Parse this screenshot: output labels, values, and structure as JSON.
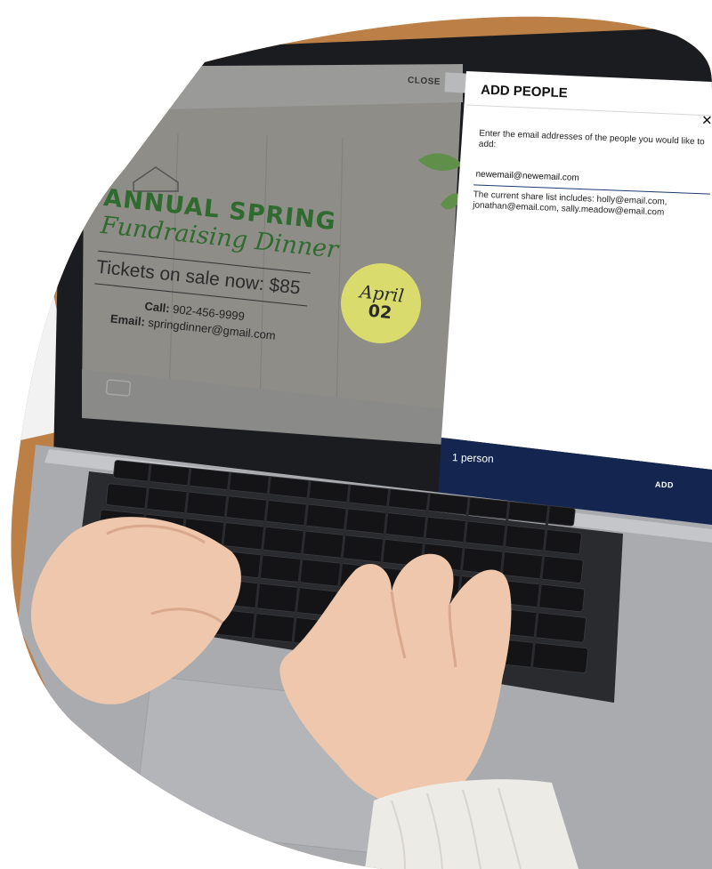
{
  "screen": {
    "close_label": "CLOSE"
  },
  "flyer": {
    "title_line1": "ANNUAL SPRING",
    "title_line2": "Fundraising Dinner",
    "tickets": "Tickets on sale now: $85",
    "call_label": "Call:",
    "call_value": "902-456-9999",
    "email_label": "Email:",
    "email_value": "springdinner@gmail.com",
    "date_month": "April",
    "date_day": "02"
  },
  "dialog": {
    "title": "ADD PEOPLE",
    "close_glyph": "✕",
    "prompt": "Enter the email addresses of the people you would like to add:",
    "input_value": "newemail@newemail.com",
    "share_list": "The current share list includes:  holly@email.com, jonathan@email.com, sally.meadow@email.com",
    "count": "1 person",
    "add_label": "ADD"
  },
  "colors": {
    "dialog_footer": "#14254f",
    "input_underline": "#1b3a73",
    "flyer_green": "#2f6a2f",
    "badge_yellow": "#d9dc6c",
    "desk_wood": "#b77a42",
    "laptop_silver": "#a9abaf"
  }
}
